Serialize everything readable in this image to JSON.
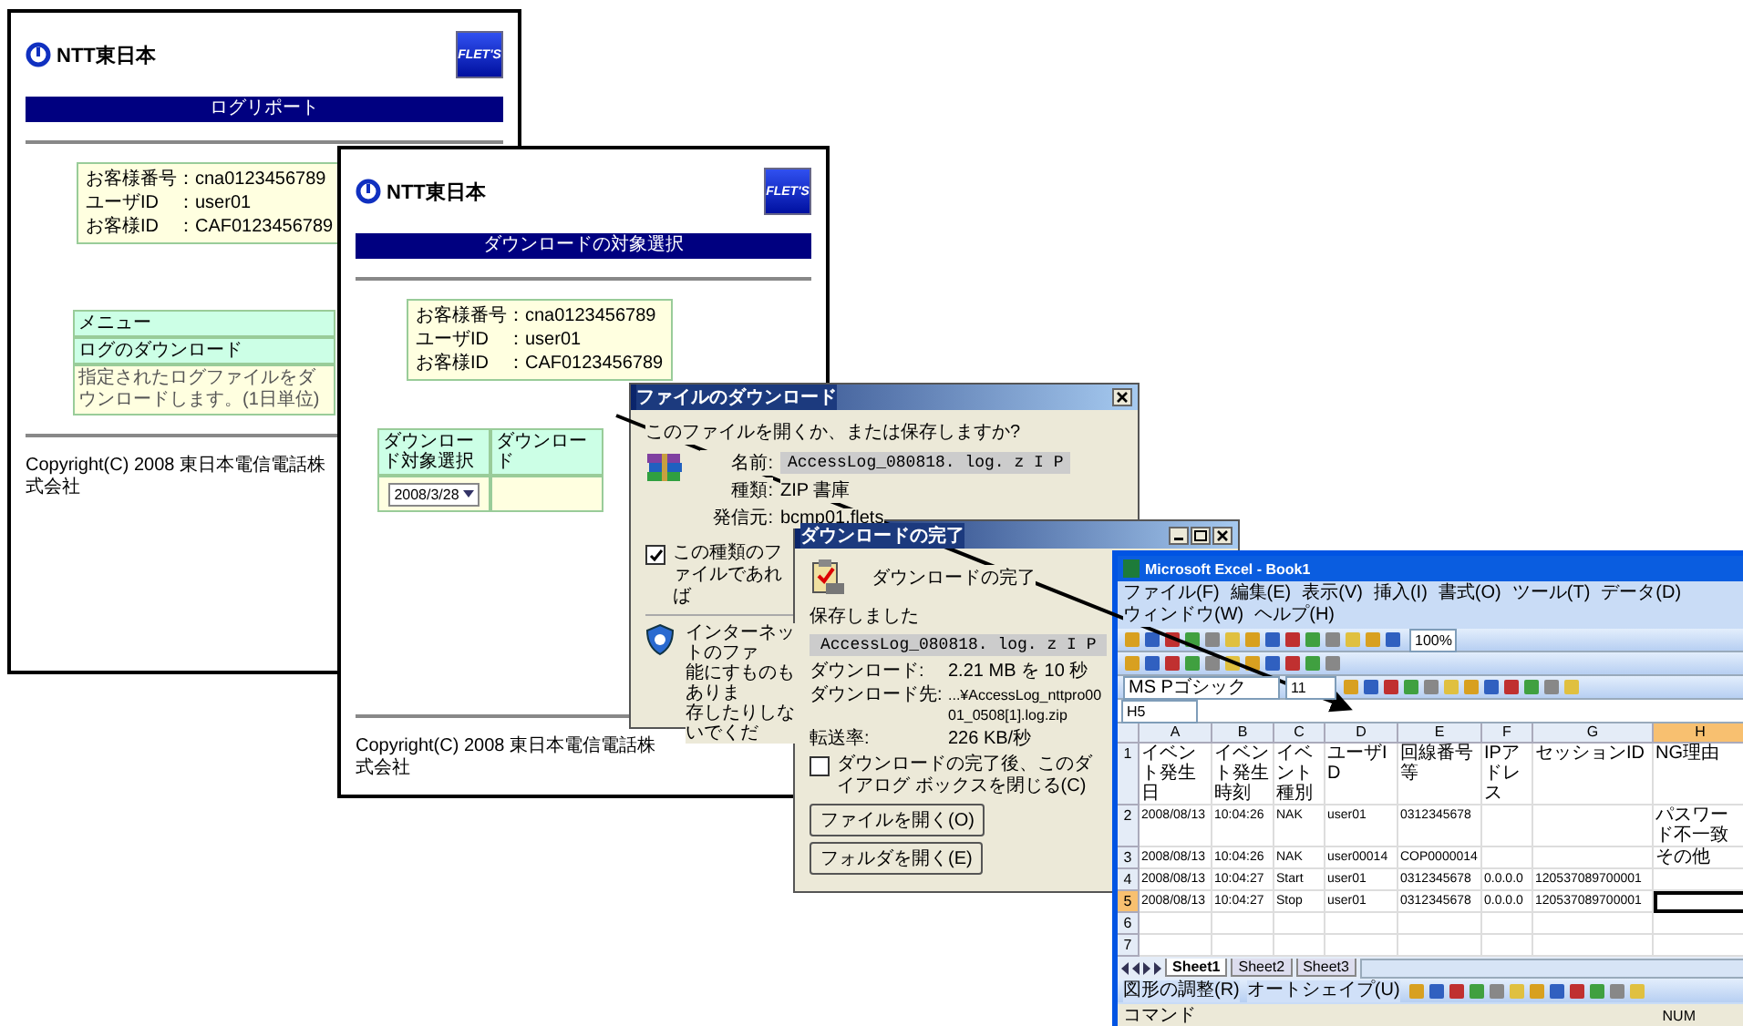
{
  "log_report_page": {
    "logo": "NTT東日本",
    "badge": "FLET'S",
    "title": "ログリポート",
    "info": [
      "お客様番号：cna0123456789",
      "ユーザID　：user01",
      "お客様ID　：CAF0123456789"
    ],
    "menu": {
      "header": "メニュー",
      "items": [
        {
          "label": "ログのダウンロード",
          "description": "指定されたログファイルをダウンロードします。(1日単位)"
        }
      ]
    },
    "copyright": "Copyright(C) 2008 東日本電信電話株式会社"
  },
  "download_select_page": {
    "logo": "NTT東日本",
    "badge": "FLET'S",
    "title": "ダウンロードの対象選択",
    "info": [
      "お客様番号：cna0123456789",
      "ユーザID　：user01",
      "お客様ID　：CAF0123456789"
    ],
    "table": {
      "columns": [
        "ダウンロード対象選択",
        "ダウンロード"
      ],
      "date": "2008/3/28"
    },
    "copyright": "Copyright(C) 2008 東日本電信電話株式会社"
  },
  "file_download_dialog": {
    "title": "ファイルのダウンロード",
    "question": "このファイルを開くか、または保存しますか?",
    "fields": [
      {
        "label": "名前:",
        "value": "AccessLog_080818. log. z I P",
        "kind": "field"
      },
      {
        "label": "種類:",
        "value": "ZIP 書庫",
        "kind": "text"
      },
      {
        "label": "発信元:",
        "value": "bcmp01.flets",
        "kind": "text"
      }
    ],
    "checkbox": {
      "label": "この種類のファイルであれば",
      "checked": true
    },
    "warning": [
      "インターネットのファ",
      "能にすものもありま",
      "存したりしないでくだ"
    ]
  },
  "download_complete_dialog": {
    "title": "ダウンロードの完了",
    "heading": "ダウンロードの完了",
    "saved_label": "保存しました",
    "file": "AccessLog_080818. log. z I P",
    "details": [
      {
        "label": "ダウンロード:",
        "value": "2.21 MB を 10 秒"
      },
      {
        "label": "ダウンロード先:",
        "value": "...¥AccessLog_nttpro0001_0508[1].log.zip"
      },
      {
        "label": "転送率:",
        "value": "226 KB/秒"
      }
    ],
    "checkbox": {
      "label": "ダウンロードの完了後、このダイアログ ボックスを閉じる(C)",
      "checked": false
    },
    "buttons": [
      "ファイルを開く(O)",
      "フォルダを開く(E)"
    ]
  },
  "excel": {
    "title": "Microsoft Excel - Book1",
    "menu": [
      "ファイル(F)",
      "編集(E)",
      "表示(V)",
      "挿入(I)",
      "書式(O)",
      "ツール(T)",
      "データ(D)",
      "ウィンドウ(W)",
      "ヘルプ(H)"
    ],
    "zoom": "100%",
    "font": "MS Pゴシック",
    "font_size": "11",
    "name_box": "H5",
    "columns": [
      {
        "label": "A",
        "selected": false
      },
      {
        "label": "B",
        "selected": false
      },
      {
        "label": "C",
        "selected": false
      },
      {
        "label": "D",
        "selected": false
      },
      {
        "label": "E",
        "selected": false
      },
      {
        "label": "F",
        "selected": false
      },
      {
        "label": "G",
        "selected": false
      },
      {
        "label": "H",
        "selected": true
      }
    ],
    "rows": [
      {
        "number": "1",
        "selected": false,
        "A": "イベント発生日",
        "B": "イベント発生時刻",
        "C": "イベント種別",
        "D": "ユーザID",
        "E": "回線番号等",
        "F": "IPアドレス",
        "G": "セッションID",
        "H": "NG理由"
      },
      {
        "number": "2",
        "selected": false,
        "A": "2008/08/13",
        "B": "10:04:26",
        "C": "NAK",
        "D": "user01",
        "E": "0312345678",
        "H": "パスワード不一致"
      },
      {
        "number": "3",
        "selected": false,
        "A": "2008/08/13",
        "B": "10:04:26",
        "C": "NAK",
        "D": "user00014",
        "E": "COP0000014",
        "H": "その他"
      },
      {
        "number": "4",
        "selected": false,
        "A": "2008/08/13",
        "B": "10:04:27",
        "C": "Start",
        "D": "user01",
        "E": "0312345678",
        "F": "0.0.0.0",
        "G": "120537089700001"
      },
      {
        "number": "5",
        "selected": true,
        "A": "2008/08/13",
        "B": "10:04:27",
        "C": "Stop",
        "D": "user01",
        "E": "0312345678",
        "F": "0.0.0.0",
        "G": "120537089700001"
      },
      {
        "number": "6",
        "selected": false
      },
      {
        "number": "7",
        "selected": false
      }
    ],
    "sheets": [
      {
        "label": "Sheet1",
        "selected": true
      },
      {
        "label": "Sheet2",
        "selected": false
      },
      {
        "label": "Sheet3",
        "selected": false
      }
    ],
    "draw_toolbar": [
      "図形の調整(R)",
      "オートシェイプ(U)"
    ],
    "status": "コマンド",
    "indicator": "NUM"
  }
}
